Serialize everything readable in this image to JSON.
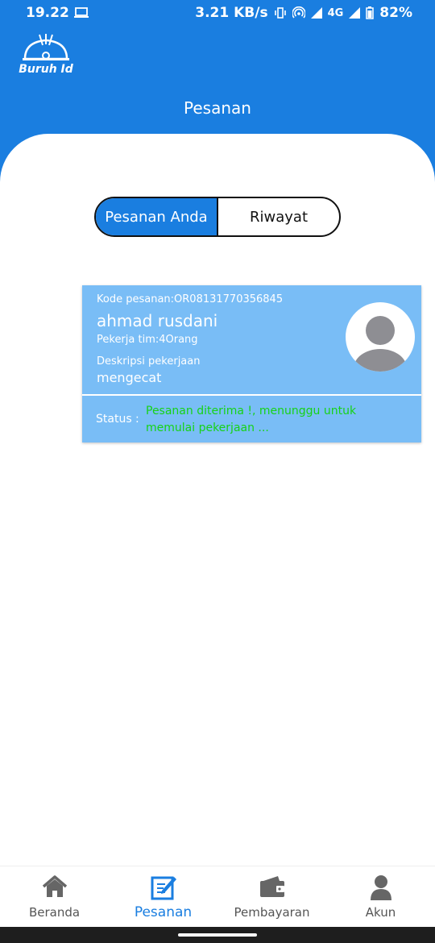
{
  "status_bar": {
    "time": "19.22",
    "network_speed": "3.21 KB/s",
    "network_type": "4G",
    "battery": "82%"
  },
  "app": {
    "logo_text": "Buruh Id"
  },
  "header": {
    "title": "Pesanan"
  },
  "tabs": [
    {
      "label": "Pesanan Anda",
      "active": true
    },
    {
      "label": "Riwayat",
      "active": false
    }
  ],
  "order": {
    "code": "Kode pesanan:OR08131770356845",
    "name": "ahmad rusdani",
    "team": "Pekerja tim:4Orang",
    "desc_label": "Deskripsi pekerjaan",
    "desc": "mengecat",
    "status_label": "Status :",
    "status_text": "Pesanan diterima !, menunggu untuk memulai pekerjaan ..."
  },
  "bottom_nav": [
    {
      "label": "Beranda",
      "icon": "home-icon",
      "active": false
    },
    {
      "label": "Pesanan",
      "icon": "edit-icon",
      "active": true
    },
    {
      "label": "Pembayaran",
      "icon": "wallet-icon",
      "active": false
    },
    {
      "label": "Akun",
      "icon": "user-icon",
      "active": false
    }
  ],
  "colors": {
    "primary": "#1a7ee0",
    "card": "#79bdf6",
    "status_green": "#16d316",
    "nav_inactive": "#555555"
  }
}
